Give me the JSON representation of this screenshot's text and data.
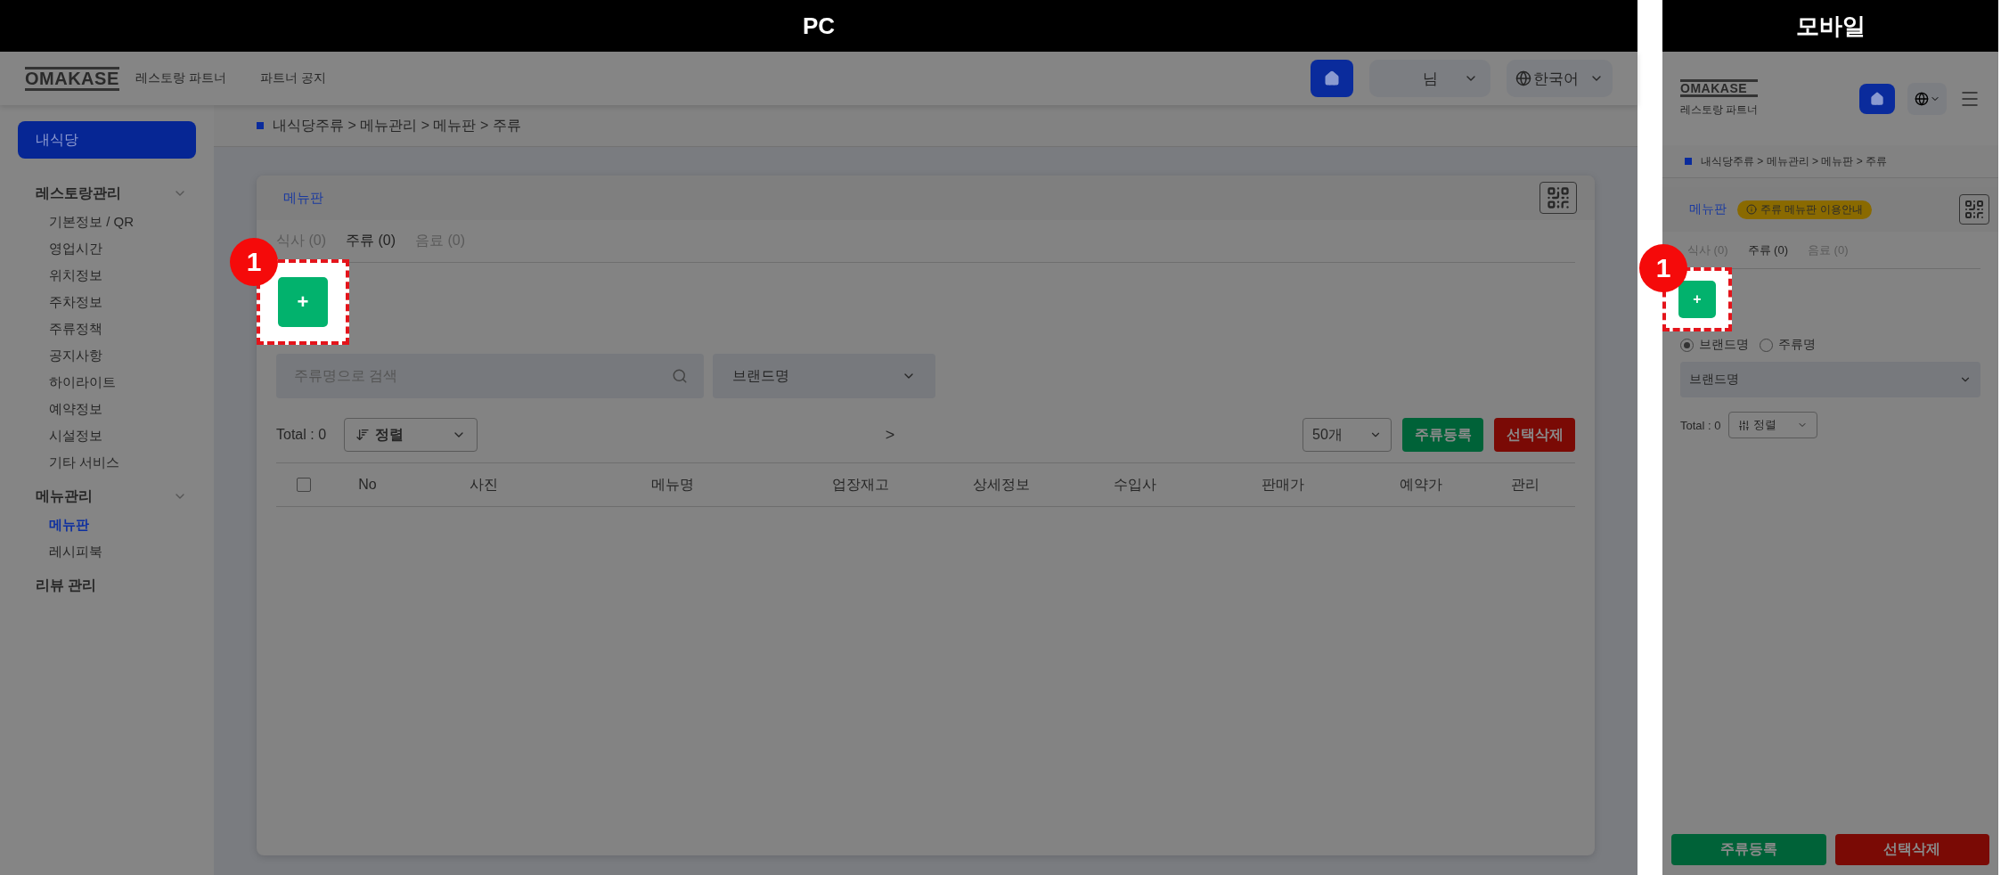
{
  "pc": {
    "label": "PC",
    "header": {
      "logo": "OMAKASE",
      "subtitle": "레스토랑 파트너",
      "notice": "파트너 공지",
      "user": "님",
      "language": "한국어"
    },
    "sidebar": {
      "home": "내식당",
      "groups": [
        {
          "title": "레스토랑관리",
          "expanded": true,
          "items": [
            {
              "label": "기본정보 / QR",
              "selected": false
            },
            {
              "label": "영업시간",
              "selected": false
            },
            {
              "label": "위치정보",
              "selected": false
            },
            {
              "label": "주차정보",
              "selected": false
            },
            {
              "label": "주류정책",
              "selected": false
            },
            {
              "label": "공지사항",
              "selected": false
            },
            {
              "label": "하이라이트",
              "selected": false
            },
            {
              "label": "예약정보",
              "selected": false
            },
            {
              "label": "시설정보",
              "selected": false
            },
            {
              "label": "기타 서비스",
              "selected": false
            }
          ]
        },
        {
          "title": "메뉴관리",
          "expanded": true,
          "items": [
            {
              "label": "메뉴판",
              "selected": true
            },
            {
              "label": "레시피북",
              "selected": false
            }
          ]
        },
        {
          "title": "리뷰 관리"
        }
      ]
    },
    "breadcrumb": "내식당주류 > 메뉴관리 > 메뉴판 > 주류",
    "card": {
      "title": "메뉴판",
      "tabs": [
        {
          "label": "식사 (0)",
          "selected": false
        },
        {
          "label": "주류 (0)",
          "selected": true
        },
        {
          "label": "음료 (0)",
          "selected": false
        }
      ],
      "callout_number": "1",
      "add_button": "+",
      "search_placeholder": "주류명으로 검색",
      "brand_select": "브랜드명",
      "total": "Total : 0",
      "sort": "정렬",
      "next_page": ">",
      "page_size": "50개",
      "register_button": "주류등록",
      "delete_button": "선택삭제",
      "select_all_checked": false,
      "columns": [
        "No",
        "사진",
        "메뉴명",
        "업장재고",
        "상세정보",
        "수입사",
        "판매가",
        "예약가",
        "관리"
      ]
    }
  },
  "mobile": {
    "label": "모바일",
    "header": {
      "logo": "OMAKASE",
      "subtitle": "레스토랑 파트너"
    },
    "breadcrumb": "내식당주류 > 메뉴관리 > 메뉴판 > 주류",
    "card": {
      "title": "메뉴판",
      "guide_badge": "주류 메뉴판 이용안내",
      "tabs": [
        {
          "label": "식사 (0)",
          "selected": false
        },
        {
          "label": "주류 (0)",
          "selected": true
        },
        {
          "label": "음료 (0)",
          "selected": false
        }
      ],
      "callout_number": "1",
      "add_button": "+",
      "radios": [
        {
          "label": "브랜드명",
          "selected": true
        },
        {
          "label": "주류명",
          "selected": false
        }
      ],
      "brand_select": "브랜드명",
      "total": "Total : 0",
      "sort": "정렬"
    },
    "register_button": "주류등록",
    "delete_button": "선택삭제"
  }
}
